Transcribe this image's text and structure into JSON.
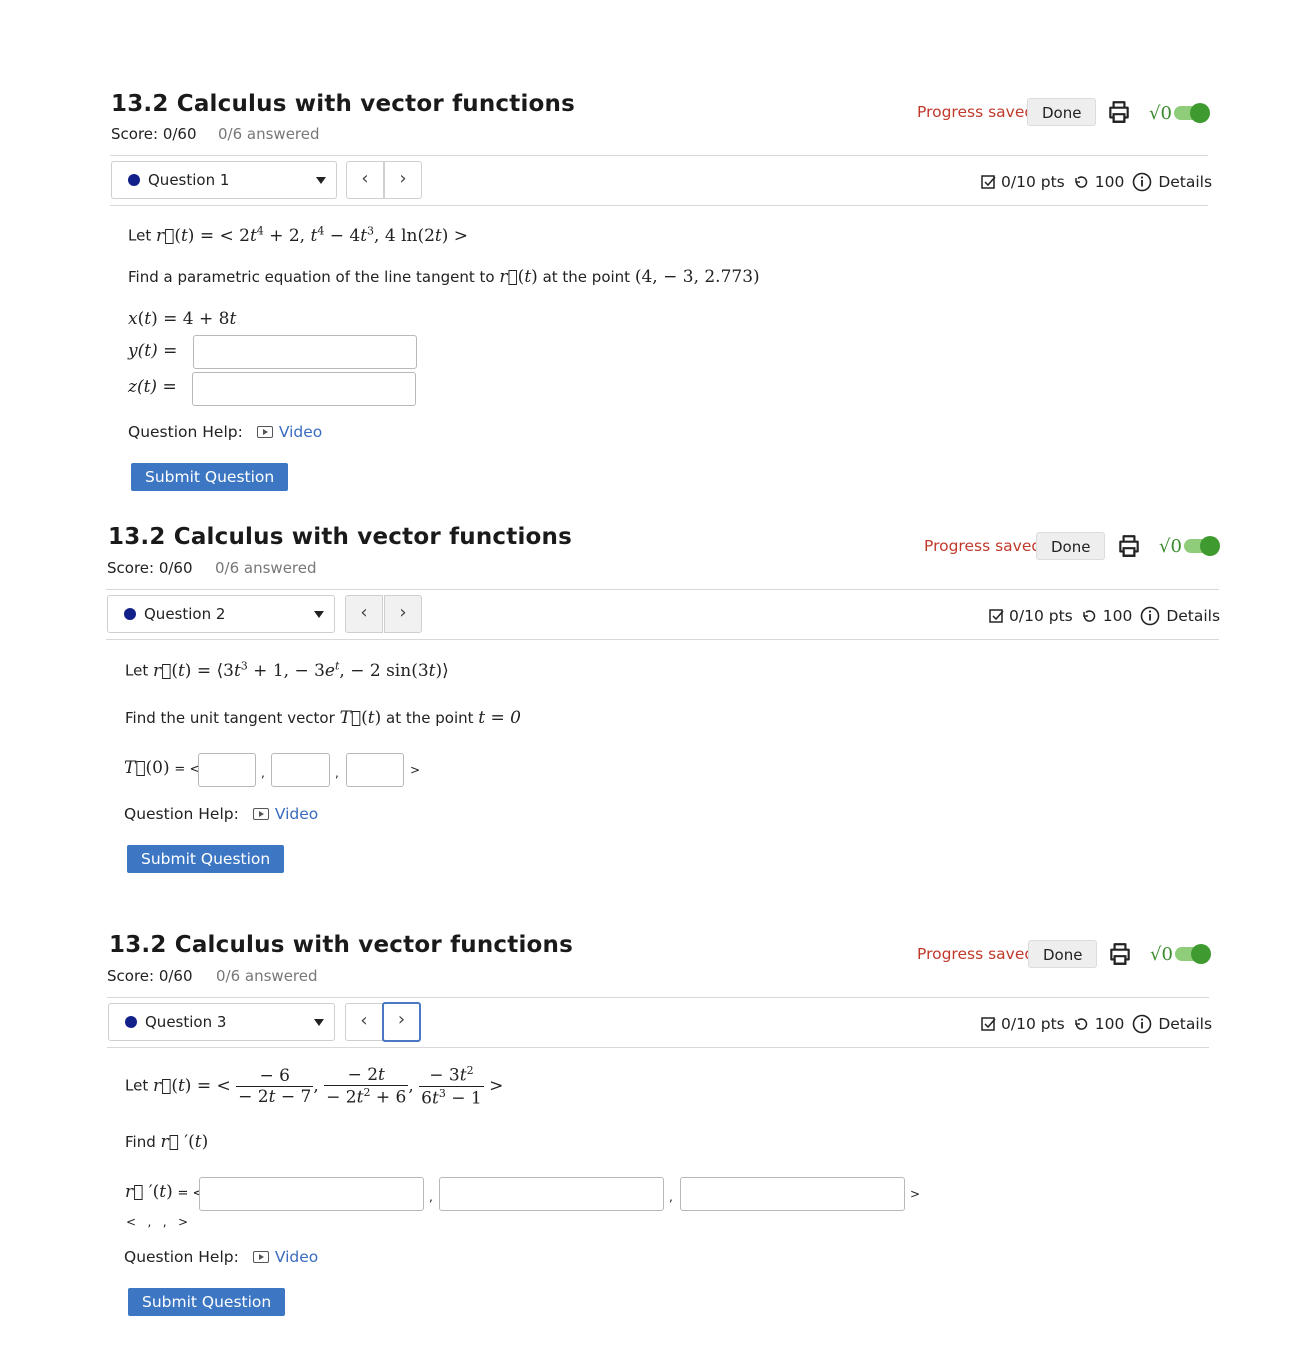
{
  "header": {
    "title": "13.2 Calculus with vector functions",
    "score": "Score: 0/60",
    "answered": "0/6 answered",
    "progress": "Progress saved",
    "done_label": "Done",
    "sqrt_label": "√0"
  },
  "pts_bar": {
    "points": "0/10 pts",
    "attempts": "100",
    "details": "Details"
  },
  "help": {
    "label": "Question Help:",
    "video": "Video"
  },
  "submit_label": "Submit Question",
  "questions": [
    {
      "label": "Question 1",
      "let_prefix": "Let",
      "find_text": "Find a parametric equation of the line tangent to",
      "find_mid": "at the point",
      "point": "(4, − 3, 2.773)",
      "x_expr": "= 4 + 8",
      "y_label": "y(t) =",
      "z_label": "z(t) ="
    },
    {
      "label": "Question 2",
      "let_prefix": "Let",
      "find_text": "Find the unit tangent vector",
      "find_mid": "at the point",
      "t_eq": "t = 0",
      "answer_prefix": "= <",
      "answer_suffix": ">",
      "comma": ","
    },
    {
      "label": "Question 3",
      "let_prefix": "Let",
      "find_text": "Find",
      "answer_prefix": "= <",
      "answer_suffix": ">",
      "comma": ",",
      "preview": "<   ,   ,   >"
    }
  ],
  "colors": {
    "accent_blue": "#3d77c4",
    "progress_red": "#c0392b",
    "toggle_green": "#3f9b30",
    "question_dot": "#12218a"
  }
}
